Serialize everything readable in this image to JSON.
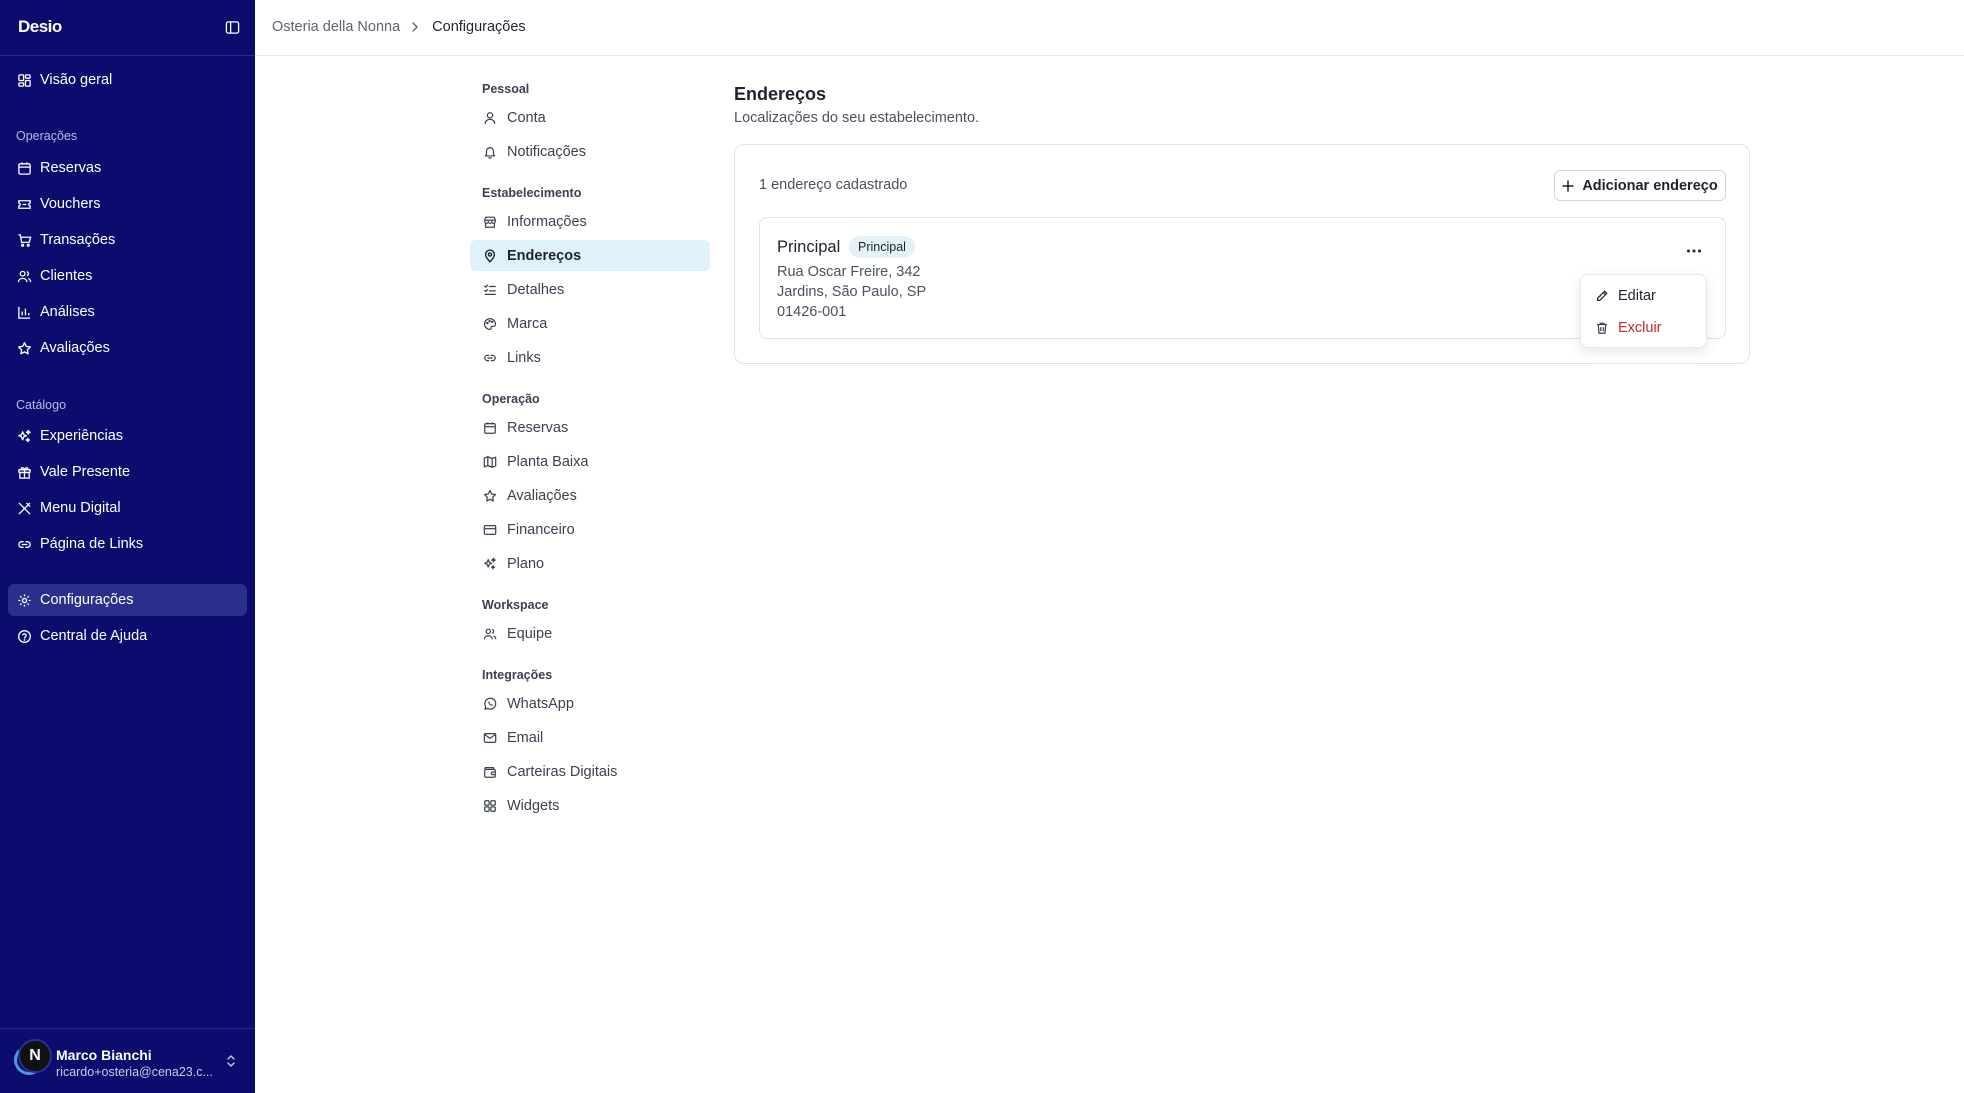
{
  "app": {
    "logo": "Desio"
  },
  "sidebar": {
    "overview_label": "Visão geral",
    "sections": {
      "operations": "Operações",
      "catalog": "Catálogo"
    },
    "operations_items": [
      {
        "label": "Reservas",
        "icon": "calendar-icon"
      },
      {
        "label": "Vouchers",
        "icon": "ticket-icon"
      },
      {
        "label": "Transações",
        "icon": "cart-icon"
      },
      {
        "label": "Clientes",
        "icon": "users-icon"
      },
      {
        "label": "Análises",
        "icon": "bar-chart-icon"
      },
      {
        "label": "Avaliações",
        "icon": "star-icon"
      }
    ],
    "catalog_items": [
      {
        "label": "Experiências",
        "icon": "sparkles-icon"
      },
      {
        "label": "Vale Presente",
        "icon": "gift-icon"
      },
      {
        "label": "Menu Digital",
        "icon": "utensils-icon"
      },
      {
        "label": "Página de Links",
        "icon": "link-icon"
      }
    ],
    "bottom_items": [
      {
        "label": "Configurações",
        "icon": "gear-icon",
        "active": true
      },
      {
        "label": "Central de Ajuda",
        "icon": "help-circle-icon"
      }
    ],
    "user": {
      "initial": "N",
      "name": "Marco Bianchi",
      "email": "ricardo+osteria@cena23.c..."
    }
  },
  "breadcrumb": {
    "parent": "Osteria della Nonna",
    "current": "Configurações"
  },
  "settings_nav": {
    "sections": [
      {
        "title": "Pessoal",
        "items": [
          {
            "label": "Conta",
            "icon": "user-icon"
          },
          {
            "label": "Notificações",
            "icon": "bell-icon"
          }
        ]
      },
      {
        "title": "Estabelecimento",
        "items": [
          {
            "label": "Informações",
            "icon": "store-icon"
          },
          {
            "label": "Endereços",
            "icon": "map-pin-icon",
            "active": true
          },
          {
            "label": "Detalhes",
            "icon": "list-checks-icon"
          },
          {
            "label": "Marca",
            "icon": "palette-icon"
          },
          {
            "label": "Links",
            "icon": "link-icon"
          }
        ]
      },
      {
        "title": "Operação",
        "items": [
          {
            "label": "Reservas",
            "icon": "calendar-icon"
          },
          {
            "label": "Planta Baixa",
            "icon": "map-icon"
          },
          {
            "label": "Avaliações",
            "icon": "star-icon"
          },
          {
            "label": "Financeiro",
            "icon": "credit-card-icon"
          },
          {
            "label": "Plano",
            "icon": "sparkles-icon"
          }
        ]
      },
      {
        "title": "Workspace",
        "items": [
          {
            "label": "Equipe",
            "icon": "users-icon"
          }
        ]
      },
      {
        "title": "Integrações",
        "items": [
          {
            "label": "WhatsApp",
            "icon": "whatsapp-icon"
          },
          {
            "label": "Email",
            "icon": "mail-icon"
          },
          {
            "label": "Carteiras Digitais",
            "icon": "wallet-icon"
          },
          {
            "label": "Widgets",
            "icon": "grid-icon"
          }
        ]
      }
    ]
  },
  "content": {
    "title": "Endereços",
    "subtitle": "Localizações do seu estabelecimento.",
    "count_text": "1 endereço cadastrado",
    "add_button_label": "Adicionar endereço",
    "address": {
      "name": "Principal",
      "badge": "Principal",
      "line1": "Rua Oscar Freire, 342",
      "line2": "Jardins, São Paulo, SP",
      "line3": "01426-001"
    },
    "menu": {
      "edit_label": "Editar",
      "delete_label": "Excluir"
    }
  },
  "colors": {
    "sidebar_bg": "#0c0c6e",
    "active_settings_bg": "#dff1fb",
    "danger": "#c42a2a"
  }
}
